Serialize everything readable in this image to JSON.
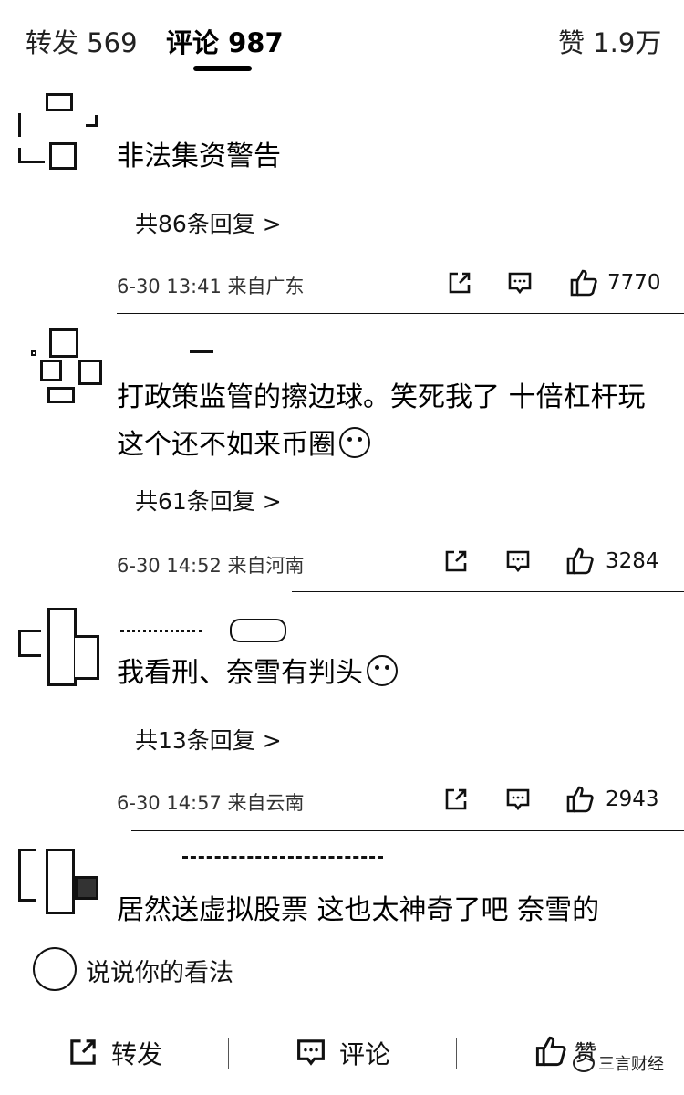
{
  "tabs": {
    "repost": "转发 569",
    "comment": "评论 987",
    "like": "赞 1.9万"
  },
  "comments": [
    {
      "text": "非法集资警告",
      "replies": "共86条回复 >",
      "meta": "6-30 13:41 来自广东",
      "likes": "7770"
    },
    {
      "text": "打政策监管的擦边球。笑死我了 十倍杠杆玩这个还不如来币圈",
      "replies": "共61条回复 >",
      "meta": "6-30 14:52 来自河南",
      "likes": "3284"
    },
    {
      "text": "我看刑、奈雪有判头",
      "replies": "共13条回复 >",
      "meta": "6-30 14:57 来自云南",
      "likes": "2943"
    },
    {
      "text": "居然送虚拟股票 这也太神奇了吧 奈雪的",
      "replies": "",
      "meta": "",
      "likes": ""
    }
  ],
  "input": {
    "placeholder": "说说你的看法"
  },
  "bottom_bar": {
    "repost": "转发",
    "comment": "评论",
    "like": "赞"
  },
  "watermark": "三言财经",
  "icons": {
    "share": "share-icon",
    "comment": "comment-icon",
    "like": "thumbs-up-icon",
    "input": "flame-icon"
  }
}
